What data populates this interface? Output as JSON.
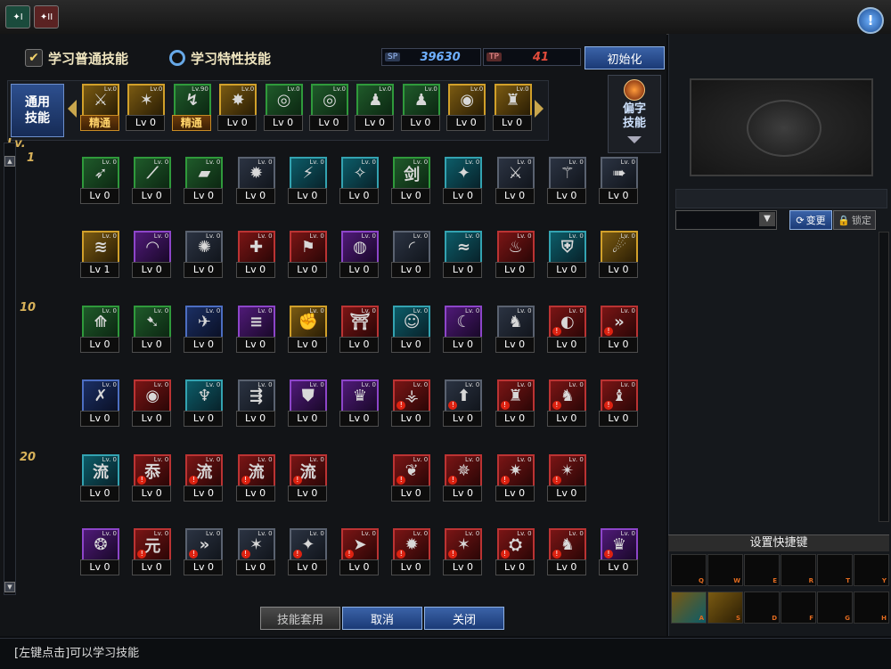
{
  "top": {
    "tab1": "✦I",
    "tab2": "✦II",
    "help": "!"
  },
  "modes": {
    "normal": "学习普通技能",
    "special": "学习特性技能"
  },
  "points": {
    "sp_tag": "SP",
    "sp": "39630",
    "tp_tag": "TP",
    "tp": "41"
  },
  "reset_label": "初始化",
  "common": {
    "line1": "通用",
    "line2": "技能"
  },
  "side_skill": {
    "line1": "偏字",
    "line2": "技能"
  },
  "common_skills": [
    {
      "lbl": "精通",
      "gold": true,
      "color": "c-gold",
      "sym": "⚔",
      "lv": "Lv.0"
    },
    {
      "lbl": "Lv 0",
      "gold": false,
      "color": "c-gold",
      "sym": "✶",
      "lv": "Lv.0"
    },
    {
      "lbl": "精通",
      "gold": true,
      "color": "c-green",
      "sym": "↯",
      "lv": "Lv.90"
    },
    {
      "lbl": "Lv 0",
      "gold": false,
      "color": "c-gold",
      "sym": "✸",
      "lv": "Lv.0"
    },
    {
      "lbl": "Lv 0",
      "gold": false,
      "color": "c-green",
      "sym": "◎",
      "lv": "Lv.0"
    },
    {
      "lbl": "Lv 0",
      "gold": false,
      "color": "c-green",
      "sym": "◎",
      "lv": "Lv.0"
    },
    {
      "lbl": "Lv 0",
      "gold": false,
      "color": "c-green",
      "sym": "♟",
      "lv": "Lv.0"
    },
    {
      "lbl": "Lv 0",
      "gold": false,
      "color": "c-green",
      "sym": "♟",
      "lv": "Lv.0"
    },
    {
      "lbl": "Lv 0",
      "gold": false,
      "color": "c-gold",
      "sym": "◉",
      "lv": "Lv.0"
    },
    {
      "lbl": "Lv 0",
      "gold": false,
      "color": "c-gold",
      "sym": "♜",
      "lv": "Lv.0"
    }
  ],
  "lv_marks": [
    "Lv.",
    "1",
    "10",
    "20"
  ],
  "skill_rows": [
    [
      {
        "lbl": "Lv 0",
        "color": "c-green",
        "sym": "➶",
        "badge": false
      },
      {
        "lbl": "Lv 0",
        "color": "c-green",
        "sym": "⟋",
        "badge": false
      },
      {
        "lbl": "Lv 0",
        "color": "c-green",
        "sym": "▰",
        "badge": false
      },
      {
        "lbl": "Lv 0",
        "color": "c-dark",
        "sym": "✹",
        "badge": false
      },
      {
        "lbl": "Lv 0",
        "color": "c-teal",
        "sym": "⚡",
        "badge": false
      },
      {
        "lbl": "Lv 0",
        "color": "c-teal",
        "sym": "✧",
        "badge": false
      },
      {
        "lbl": "Lv 0",
        "color": "c-green",
        "sym": "剑",
        "badge": false
      },
      {
        "lbl": "Lv 0",
        "color": "c-teal",
        "sym": "✦",
        "badge": false
      },
      {
        "lbl": "Lv 0",
        "color": "c-dark",
        "sym": "⚔",
        "badge": false
      },
      {
        "lbl": "Lv 0",
        "color": "c-dark",
        "sym": "⚚",
        "badge": false
      },
      {
        "lbl": "Lv 0",
        "color": "c-dark",
        "sym": "➠",
        "badge": false
      }
    ],
    [
      {
        "lbl": "Lv 1",
        "color": "c-gold",
        "sym": "≋",
        "badge": false
      },
      {
        "lbl": "Lv 0",
        "color": "c-purple",
        "sym": "◠",
        "badge": false
      },
      {
        "lbl": "Lv 0",
        "color": "c-dark",
        "sym": "✺",
        "badge": false
      },
      {
        "lbl": "Lv 0",
        "color": "c-red",
        "sym": "✚",
        "badge": false
      },
      {
        "lbl": "Lv 0",
        "color": "c-red",
        "sym": "⚑",
        "badge": false
      },
      {
        "lbl": "Lv 0",
        "color": "c-purple",
        "sym": "◍",
        "badge": false
      },
      {
        "lbl": "Lv 0",
        "color": "c-dark",
        "sym": "◜",
        "badge": false
      },
      {
        "lbl": "Lv 0",
        "color": "c-teal",
        "sym": "≈",
        "badge": false
      },
      {
        "lbl": "Lv 0",
        "color": "c-red",
        "sym": "♨",
        "badge": false
      },
      {
        "lbl": "Lv 0",
        "color": "c-teal",
        "sym": "⛨",
        "badge": false
      },
      {
        "lbl": "Lv 0",
        "color": "c-gold",
        "sym": "☄",
        "badge": false
      }
    ],
    [
      {
        "lbl": "Lv 0",
        "color": "c-green",
        "sym": "⟰",
        "badge": false
      },
      {
        "lbl": "Lv 0",
        "color": "c-green",
        "sym": "➷",
        "badge": false
      },
      {
        "lbl": "Lv 0",
        "color": "c-navy",
        "sym": "✈",
        "badge": false
      },
      {
        "lbl": "Lv 0",
        "color": "c-purple",
        "sym": "≡",
        "badge": false
      },
      {
        "lbl": "Lv 0",
        "color": "c-gold",
        "sym": "✊",
        "badge": false
      },
      {
        "lbl": "Lv 0",
        "color": "c-red",
        "sym": "⛩",
        "badge": false
      },
      {
        "lbl": "Lv 0",
        "color": "c-teal",
        "sym": "☺",
        "badge": false
      },
      {
        "lbl": "Lv 0",
        "color": "c-purple",
        "sym": "☾",
        "badge": false
      },
      {
        "lbl": "Lv 0",
        "color": "c-dark",
        "sym": "♞",
        "badge": false
      },
      {
        "lbl": "Lv 0",
        "color": "c-red",
        "sym": "◐",
        "badge": true
      },
      {
        "lbl": "Lv 0",
        "color": "c-red",
        "sym": "»",
        "badge": true
      }
    ],
    [
      {
        "lbl": "Lv 0",
        "color": "c-navy",
        "sym": "✗",
        "badge": false
      },
      {
        "lbl": "Lv 0",
        "color": "c-red",
        "sym": "◉",
        "badge": false
      },
      {
        "lbl": "Lv 0",
        "color": "c-teal",
        "sym": "♆",
        "badge": false
      },
      {
        "lbl": "Lv 0",
        "color": "c-dark",
        "sym": "⇶",
        "badge": false
      },
      {
        "lbl": "Lv 0",
        "color": "c-purple",
        "sym": "⛊",
        "badge": false
      },
      {
        "lbl": "Lv 0",
        "color": "c-purple",
        "sym": "♛",
        "badge": false
      },
      {
        "lbl": "Lv 0",
        "color": "c-red",
        "sym": "⚶",
        "badge": true
      },
      {
        "lbl": "Lv 0",
        "color": "c-dark",
        "sym": "⬆",
        "badge": true
      },
      {
        "lbl": "Lv 0",
        "color": "c-red",
        "sym": "♜",
        "badge": true
      },
      {
        "lbl": "Lv 0",
        "color": "c-red",
        "sym": "♞",
        "badge": true
      },
      {
        "lbl": "Lv 0",
        "color": "c-red",
        "sym": "♝",
        "badge": true
      }
    ],
    [
      {
        "lbl": "Lv 0",
        "color": "c-teal",
        "sym": "流",
        "badge": false
      },
      {
        "lbl": "Lv 0",
        "color": "c-red",
        "sym": "忝",
        "badge": true
      },
      {
        "lbl": "Lv 0",
        "color": "c-red",
        "sym": "流",
        "badge": true
      },
      {
        "lbl": "Lv 0",
        "color": "c-red",
        "sym": "流",
        "badge": true
      },
      {
        "lbl": "Lv 0",
        "color": "c-red",
        "sym": "流",
        "badge": true
      },
      null,
      {
        "lbl": "Lv 0",
        "color": "c-red",
        "sym": "❦",
        "badge": true
      },
      {
        "lbl": "Lv 0",
        "color": "c-red",
        "sym": "✵",
        "badge": true
      },
      {
        "lbl": "Lv 0",
        "color": "c-red",
        "sym": "✷",
        "badge": true
      },
      {
        "lbl": "Lv 0",
        "color": "c-red",
        "sym": "✴",
        "badge": true
      }
    ],
    [
      {
        "lbl": "Lv 0",
        "color": "c-purple",
        "sym": "❂",
        "badge": false
      },
      {
        "lbl": "Lv 0",
        "color": "c-red",
        "sym": "元",
        "badge": true
      },
      {
        "lbl": "Lv 0",
        "color": "c-dark",
        "sym": "»",
        "badge": true
      },
      {
        "lbl": "Lv 0",
        "color": "c-dark",
        "sym": "✶",
        "badge": true
      },
      {
        "lbl": "Lv 0",
        "color": "c-dark",
        "sym": "✦",
        "badge": true
      },
      {
        "lbl": "Lv 0",
        "color": "c-red",
        "sym": "➤",
        "badge": true
      },
      {
        "lbl": "Lv 0",
        "color": "c-red",
        "sym": "✹",
        "badge": true
      },
      {
        "lbl": "Lv 0",
        "color": "c-red",
        "sym": "✶",
        "badge": true
      },
      {
        "lbl": "Lv 0",
        "color": "c-red",
        "sym": "⛭",
        "badge": true
      },
      {
        "lbl": "Lv 0",
        "color": "c-red",
        "sym": "♞",
        "badge": true
      },
      {
        "lbl": "Lv 0",
        "color": "c-purple",
        "sym": "♛",
        "badge": true
      }
    ]
  ],
  "buttons": {
    "apply": "技能套用",
    "cancel": "取消",
    "close": "关闭"
  },
  "status": "[左键点击]可以学习技能",
  "right": {
    "change": "变更",
    "lock": "锁定",
    "shortcut_title": "设置快捷键"
  },
  "shortcut_keys": [
    "Q",
    "W",
    "E",
    "R",
    "T",
    "Y",
    "A",
    "S",
    "D",
    "F",
    "G",
    "H"
  ]
}
